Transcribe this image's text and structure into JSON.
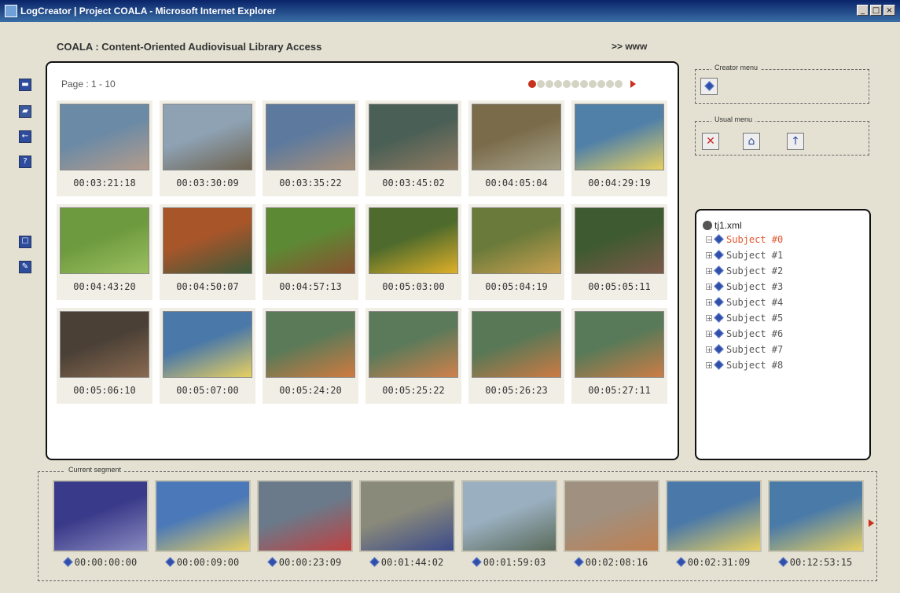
{
  "window": {
    "title": "LogCreator | Project COALA - Microsoft Internet Explorer"
  },
  "header": {
    "title": "COALA : Content-Oriented Audiovisual Library Access",
    "link": ">> www"
  },
  "toolbar": {
    "icons": [
      "save-icon",
      "open-icon",
      "back-icon",
      "help-icon",
      "select-icon",
      "edit-icon"
    ]
  },
  "grid": {
    "page_info": "Page : 1 - 10",
    "pager": {
      "total_dots": 11,
      "active_index": 0
    },
    "thumbs": [
      {
        "time": "00:03:21:18",
        "c1": "#6a8aa6",
        "c2": "#b39c8c"
      },
      {
        "time": "00:03:30:09",
        "c1": "#8ea2b4",
        "c2": "#6e6350"
      },
      {
        "time": "00:03:35:22",
        "c1": "#5d7a9e",
        "c2": "#a89078"
      },
      {
        "time": "00:03:45:02",
        "c1": "#4a5f55",
        "c2": "#8f7b62"
      },
      {
        "time": "00:04:05:04",
        "c1": "#7a6b4a",
        "c2": "#a7a28a"
      },
      {
        "time": "00:04:29:19",
        "c1": "#5080a8",
        "c2": "#e8d060"
      },
      {
        "time": "00:04:43:20",
        "c1": "#6d9a3e",
        "c2": "#9cc060"
      },
      {
        "time": "00:04:50:07",
        "c1": "#a8552a",
        "c2": "#3c5a3a"
      },
      {
        "time": "00:04:57:13",
        "c1": "#5c8a34",
        "c2": "#8a5030"
      },
      {
        "time": "00:05:03:00",
        "c1": "#4e6a2c",
        "c2": "#e0b028"
      },
      {
        "time": "00:05:04:19",
        "c1": "#6a7a3a",
        "c2": "#c8a050"
      },
      {
        "time": "00:05:05:11",
        "c1": "#3e5a30",
        "c2": "#7c5a4a"
      },
      {
        "time": "00:05:06:10",
        "c1": "#4a4036",
        "c2": "#8a6a50"
      },
      {
        "time": "00:05:07:00",
        "c1": "#4a78a8",
        "c2": "#e8d060"
      },
      {
        "time": "00:05:24:20",
        "c1": "#5a7a58",
        "c2": "#d07a40"
      },
      {
        "time": "00:05:25:22",
        "c1": "#5a7a5a",
        "c2": "#d0804a"
      },
      {
        "time": "00:05:26:23",
        "c1": "#587856",
        "c2": "#cc7a44"
      },
      {
        "time": "00:05:27:11",
        "c1": "#587a58",
        "c2": "#cc7c46"
      }
    ]
  },
  "creator_menu": {
    "label": "Creator menu",
    "icons": [
      "diamond-icon"
    ]
  },
  "usual_menu": {
    "label": "Usual menu",
    "icons": [
      "close-icon",
      "home-icon",
      "upload-icon"
    ]
  },
  "tree": {
    "root": "tj1.xml",
    "items": [
      "Subject #0",
      "Subject #1",
      "Subject #2",
      "Subject #3",
      "Subject #4",
      "Subject #5",
      "Subject #6",
      "Subject #7",
      "Subject #8"
    ],
    "selected_index": 0
  },
  "segment": {
    "label": "Current segment",
    "thumbs": [
      {
        "time": "00:00:00:00",
        "c1": "#3a3a8a",
        "c2": "#8a8ac0"
      },
      {
        "time": "00:00:09:00",
        "c1": "#4a78b8",
        "c2": "#e8d060"
      },
      {
        "time": "00:00:23:09",
        "c1": "#6a7a8a",
        "c2": "#c04040"
      },
      {
        "time": "00:01:44:02",
        "c1": "#8a8a7a",
        "c2": "#3a4a8a"
      },
      {
        "time": "00:01:59:03",
        "c1": "#9ab0c0",
        "c2": "#5a6a5a"
      },
      {
        "time": "00:02:08:16",
        "c1": "#a09080",
        "c2": "#c08050"
      },
      {
        "time": "00:02:31:09",
        "c1": "#4a78a8",
        "c2": "#e8d060"
      },
      {
        "time": "00:12:53:15",
        "c1": "#4a7aa8",
        "c2": "#e8d060"
      }
    ]
  }
}
